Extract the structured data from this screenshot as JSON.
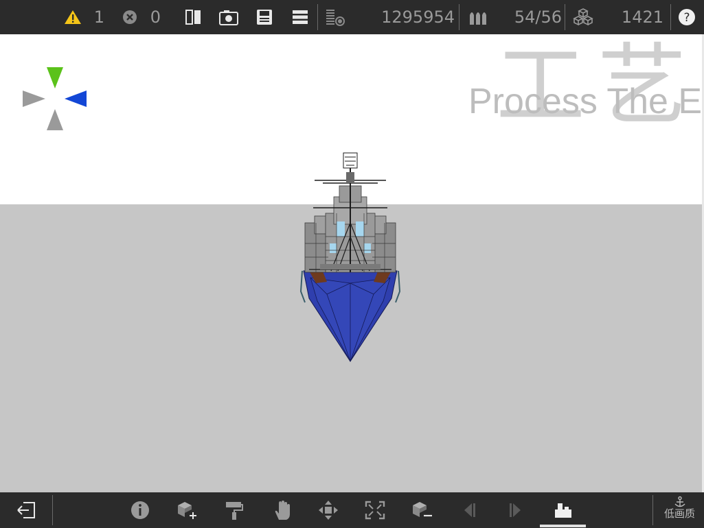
{
  "toolbar": {
    "warning_count": "1",
    "error_count": "0",
    "part_count": "1295954",
    "ammo_count": "54/56",
    "block_count": "1421",
    "help_label": "?"
  },
  "scene": {
    "watermark_cn": "工艺",
    "watermark_en": "Process The E"
  },
  "bottom": {
    "quality_label": "低画质"
  },
  "colors": {
    "bar_bg": "#2b2b2b",
    "warning_yellow": "#f5c518",
    "axis_green": "#5bc21a",
    "axis_blue": "#1347d6",
    "axis_gray": "#9a9a9a",
    "hull_blue": "#2f3fae",
    "ground": "#c6c6c6"
  },
  "icons": {
    "top": [
      "warning-icon",
      "error-icon",
      "mirror-icon",
      "screenshot-icon",
      "save-icon",
      "menu-icon",
      "part-stack-icon",
      "ammo-icon",
      "blocks-icon",
      "help-icon"
    ],
    "bottom": [
      "exit-icon",
      "info-icon",
      "add-block-icon",
      "paint-roller-icon",
      "hand-select-icon",
      "move-icon",
      "resize-icon",
      "remove-block-icon",
      "undo-icon",
      "redo-icon",
      "build-mode-icon",
      "anchor-icon"
    ]
  }
}
